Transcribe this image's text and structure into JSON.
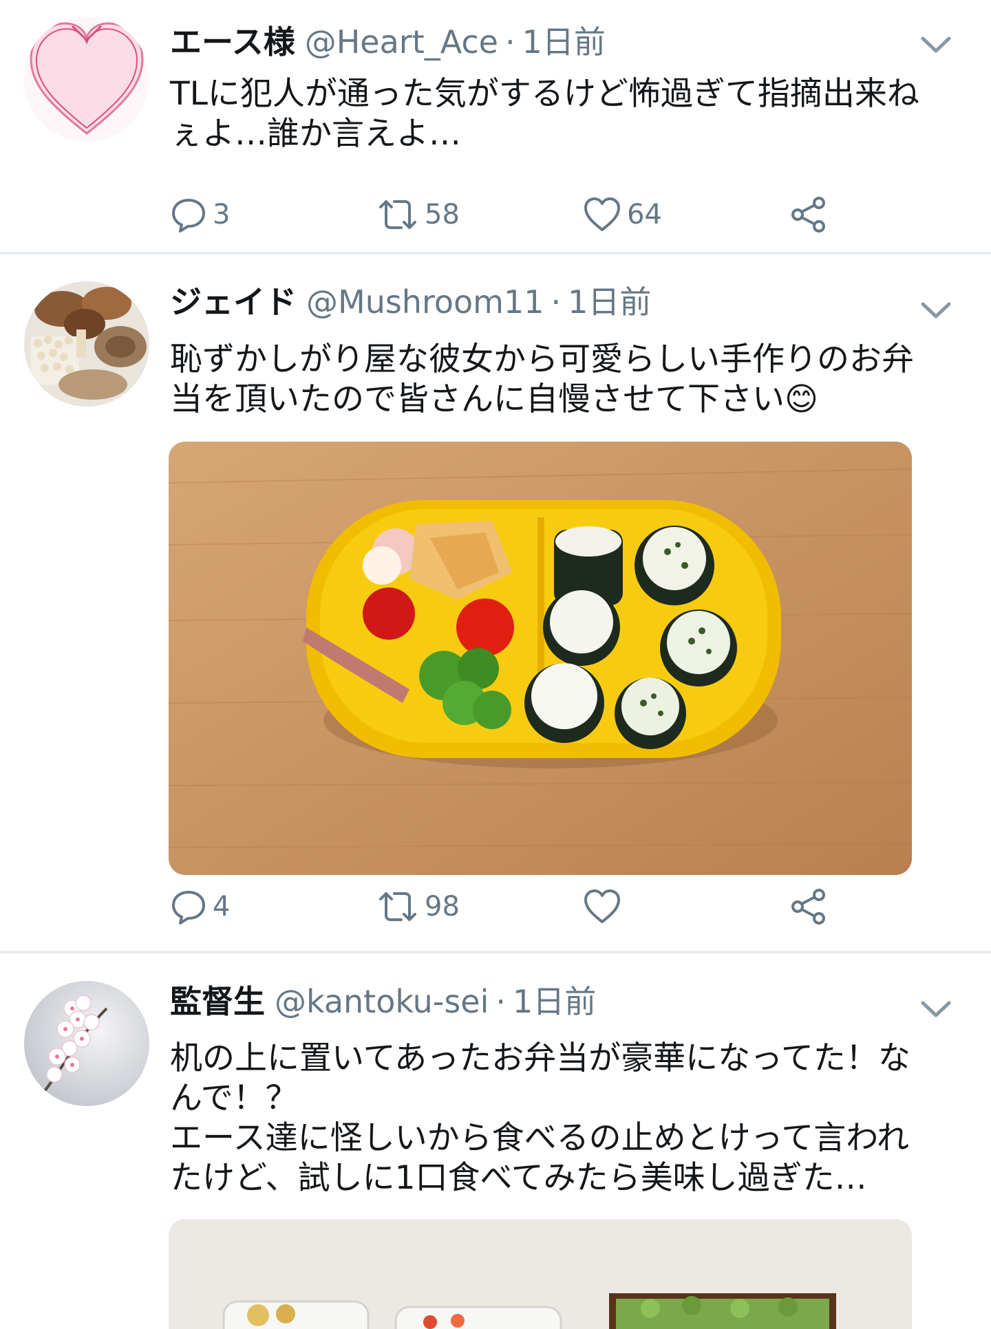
{
  "tweets": [
    {
      "name": "エース様",
      "handle": "@Heart_Ace",
      "separator": "·",
      "time": "1日前",
      "text": "TLに犯人が通った気がするけど怖過ぎて指摘出来ね\nぇよ…誰か言えよ…",
      "avatar_icon": "heart-icon",
      "counts": {
        "reply": "3",
        "retweet": "58",
        "like": "64"
      }
    },
    {
      "name": "ジェイド",
      "handle": "@Mushroom11",
      "separator": "·",
      "time": "1日前",
      "text": "恥ずかしがり屋な彼女から可愛らしい手作りのお弁\n当を頂いたので皆さんに自慢させて下さい😊",
      "avatar_icon": "mushroom-icon",
      "media": "bento-photo",
      "counts": {
        "reply": "4",
        "retweet": "98",
        "like": ""
      }
    },
    {
      "name": "監督生",
      "handle": "@kantoku-sei",
      "separator": "·",
      "time": "1日前",
      "text": "机の上に置いてあったお弁当が豪華になってた！な\nんで！？\nエース達に怪しいから食べるの止めとけって言われ\nたけど、試しに1口食べてみたら美味し過ぎた…",
      "avatar_icon": "cherry-blossom-icon",
      "media": "bento-photo-partial"
    }
  ],
  "colors": {
    "text": "#14171a",
    "secondary": "#657786",
    "divider": "#e6ecf0",
    "bento_yellow": "#f5c400",
    "wood": "#c9955f"
  },
  "icons": [
    "reply-icon",
    "retweet-icon",
    "like-icon",
    "share-icon",
    "chevron-down-icon"
  ]
}
